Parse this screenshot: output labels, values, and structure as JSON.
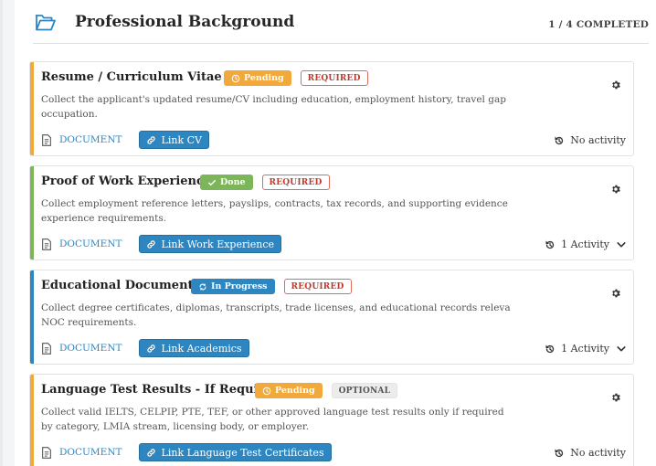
{
  "section": {
    "title": "Professional Background",
    "progress": "1 / 4 COMPLETED"
  },
  "colors": {
    "pending": "#f0a93a",
    "done": "#7cb55a",
    "in_progress": "#2e86c1",
    "required": "#c0392b",
    "link": "#2e86c1"
  },
  "cards": [
    {
      "title": "Resume / Curriculum Vitae",
      "status": "Pending",
      "requirement": "REQUIRED",
      "description": "Collect the applicant's updated resume/CV including education, employment history, travel gap occupation.",
      "doc_type": "DOCUMENT",
      "link_label": "Link CV",
      "activity": "No activity"
    },
    {
      "title": "Proof of Work Experience",
      "status": "Done",
      "requirement": "REQUIRED",
      "description": "Collect employment reference letters, payslips, contracts, tax records, and supporting evidence experience requirements.",
      "doc_type": "DOCUMENT",
      "link_label": "Link Work Experience",
      "activity": "1 Activity"
    },
    {
      "title": "Educational Documents",
      "status": "In Progress",
      "requirement": "REQUIRED",
      "description": "Collect degree certificates, diplomas, transcripts, trade licenses, and educational records releva NOC requirements.",
      "doc_type": "DOCUMENT",
      "link_label": "Link Academics",
      "activity": "1 Activity"
    },
    {
      "title": "Language Test Results - If Required",
      "status": "Pending",
      "requirement": "OPTIONAL",
      "description": "Collect valid IELTS, CELPIP, PTE, TEF, or other approved language test results only if required by category, LMIA stream, licensing body, or employer.",
      "doc_type": "DOCUMENT",
      "link_label": "Link Language Test Certificates",
      "activity": "No activity"
    }
  ]
}
